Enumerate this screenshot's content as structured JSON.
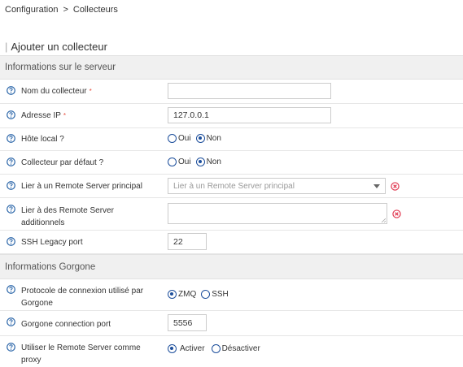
{
  "breadcrumb": {
    "root": "Configuration",
    "separator": ">",
    "current": "Collecteurs"
  },
  "page_title": "Ajouter un collecteur",
  "sections": {
    "server": "Informations sur le serveur",
    "gorgone": "Informations Gorgone"
  },
  "fields": {
    "name": {
      "label": "Nom du collecteur",
      "required_mark": "*",
      "value": ""
    },
    "ip": {
      "label": "Adresse IP",
      "required_mark": "*",
      "value": "127.0.0.1"
    },
    "localhost": {
      "label": "Hôte local ?",
      "options": [
        "Oui",
        "Non"
      ],
      "selected": "Non"
    },
    "default_poller": {
      "label": "Collecteur par défaut ?",
      "options": [
        "Oui",
        "Non"
      ],
      "selected": "Non"
    },
    "main_remote": {
      "label": "Lier à un Remote Server principal",
      "placeholder": "Lier à un Remote Server principal"
    },
    "additional_remotes": {
      "label_line1": "Lier à des Remote Server",
      "label_line2": "additionnels"
    },
    "ssh_port": {
      "label": "SSH Legacy port",
      "value": "22"
    },
    "protocol": {
      "label_line1": "Protocole de connexion utilisé par",
      "label_line2": "Gorgone",
      "options": [
        "ZMQ",
        "SSH"
      ],
      "selected": "ZMQ"
    },
    "gorgone_port": {
      "label": "Gorgone connection port",
      "value": "5556"
    },
    "proxy": {
      "label_line1": "Utiliser le Remote Server comme",
      "label_line2": "proxy",
      "options": [
        "Activer",
        "Désactiver"
      ],
      "selected": "Activer"
    }
  },
  "colors": {
    "radio": "#1d4f9c",
    "help_icon": "#2e68aa",
    "clear_icon": "#e0334c",
    "required": "#e74c3c"
  }
}
